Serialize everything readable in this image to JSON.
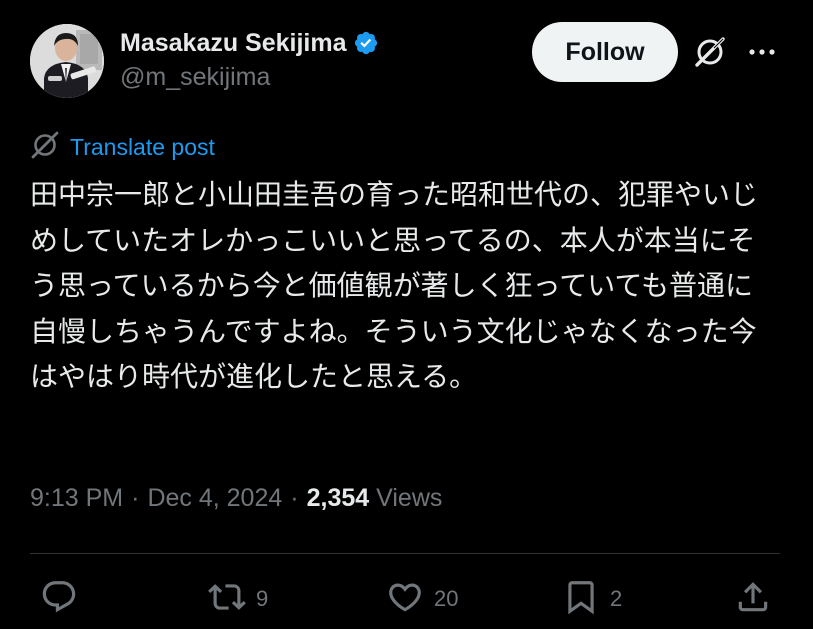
{
  "author": {
    "name": "Masakazu Sekijima",
    "handle": "@m_sekijima",
    "verified": true
  },
  "header_actions": {
    "follow_label": "Follow",
    "icons": [
      "grok-icon",
      "more-icon"
    ]
  },
  "translate": {
    "label": "Translate post",
    "icon": "translate-icon"
  },
  "post": {
    "text": "田中宗一郎と小山田圭吾の育った昭和世代の、犯罪やいじめしていたオレかっこいいと思ってるの、本人が本当にそう思っているから今と価値観が著しく狂っていても普通に自慢しちゃうんですよね。そういう文化じゃなくなった今はやはり時代が進化したと思える。"
  },
  "meta": {
    "time": "9:13 PM",
    "separator": "·",
    "date": "Dec 4, 2024",
    "views_count": "2,354",
    "views_label": "Views"
  },
  "actions": {
    "reply_count": "",
    "repost_count": "9",
    "like_count": "20",
    "bookmark_count": "2"
  },
  "colors": {
    "background": "#000000",
    "text_primary": "#e7e9ea",
    "text_secondary": "#71767b",
    "link": "#1d9bf0",
    "verified_badge": "#1d9bf0",
    "follow_button_bg": "#eff3f4",
    "divider": "#2f3336"
  }
}
